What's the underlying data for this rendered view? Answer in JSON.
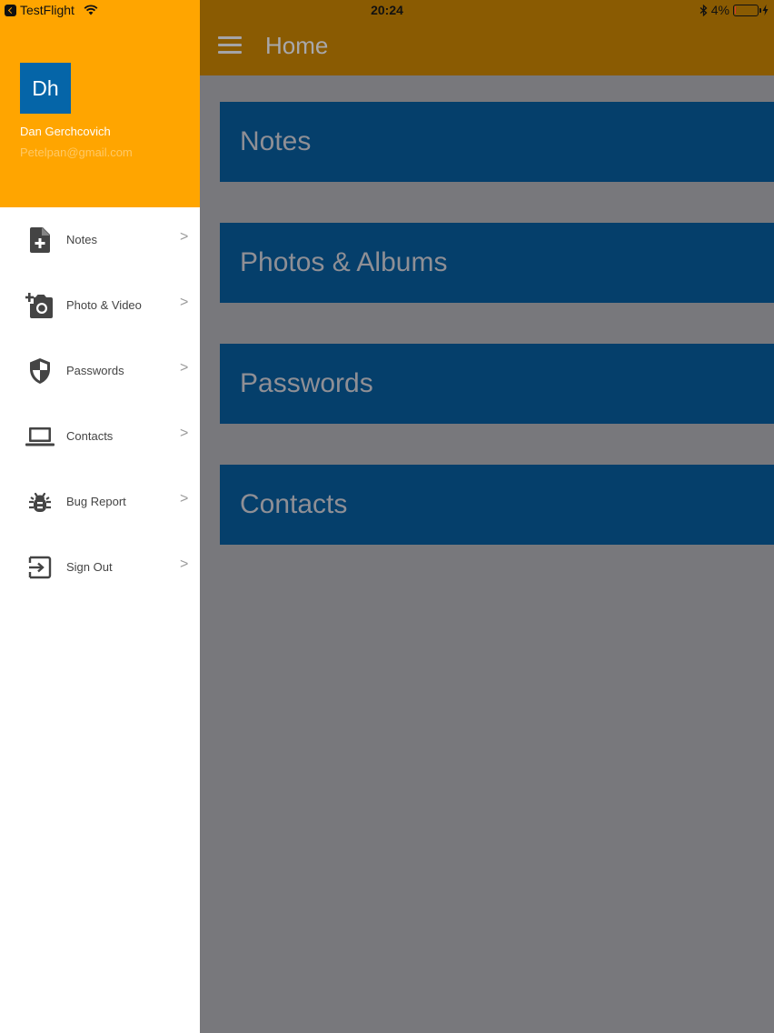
{
  "status_bar": {
    "back_app": "TestFlight",
    "time": "20:24",
    "battery_percent": "4%",
    "battery_level": 0.04
  },
  "header": {
    "title": "Home"
  },
  "cards": [
    {
      "label": "Notes"
    },
    {
      "label": "Photos & Albums"
    },
    {
      "label": "Passwords"
    },
    {
      "label": "Contacts"
    }
  ],
  "drawer": {
    "avatar_initials": "Dh",
    "user_name": "Dan Gerchcovich",
    "user_email": "Petelpan@gmail.com",
    "chevron": ">",
    "items": [
      {
        "label": "Notes",
        "icon": "note-add-icon"
      },
      {
        "label": "Photo & Video",
        "icon": "add-camera-icon"
      },
      {
        "label": "Passwords",
        "icon": "shield-icon"
      },
      {
        "label": "Contacts",
        "icon": "laptop-icon"
      },
      {
        "label": "Bug Report",
        "icon": "bug-icon"
      },
      {
        "label": "Sign Out",
        "icon": "exit-icon"
      }
    ]
  },
  "colors": {
    "accent": "#ffa500",
    "header_dimmed": "#8a5b02",
    "card": "#053f6b",
    "avatar": "#0565a8",
    "overlay": "#78787c"
  }
}
